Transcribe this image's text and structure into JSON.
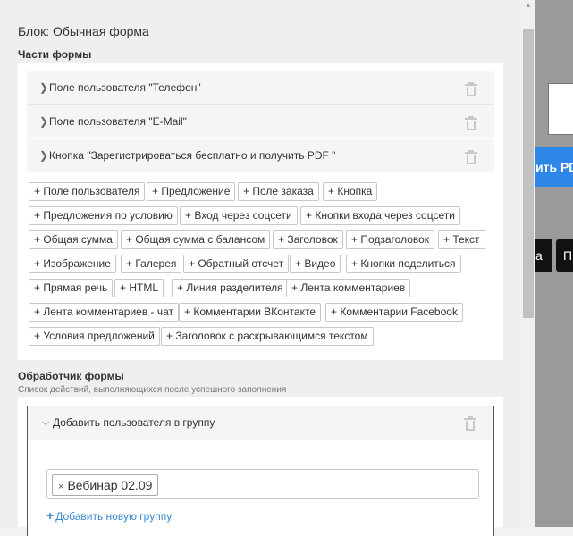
{
  "background": {
    "button_text": "ить PDF",
    "dark_btn_1": "а",
    "dark_btn_2": "П"
  },
  "panel": {
    "block_title": "Блок: Обычная форма",
    "parts_title": "Части формы",
    "parts": [
      "Поле пользователя \"Телефон\"",
      "Поле пользователя \"E-Mail\"",
      "Кнопка \"Зарегистрироваться бесплатно и получить PDF \""
    ],
    "tags": [
      "+ Поле пользователя",
      "+ Предложение",
      "+ Поле заказа",
      "+ Кнопка",
      "+ Предложения по условию",
      "+ Вход через соцсети",
      "+ Кнопки входа через соцсети",
      "+ Общая сумма",
      "+ Общая сумма с балансом",
      "+ Заголовок",
      "+ Подзаголовок",
      "+ Текст",
      "+ Изображение",
      "+ Галерея",
      "+ Обратный отсчет",
      "+ Видео",
      "+ Кнопки поделиться",
      "+ Прямая речь",
      "+ HTML",
      "+ Линия разделителя",
      "+ Лента комментариев",
      "+ Лента комментариев - чат",
      "+ Комментарии ВКонтакте",
      "+ Комментарии Facebook",
      "+ Условия предложений",
      "+ Заголовок с раскрывающимся текстом"
    ],
    "handler_title": "Обработчик формы",
    "handler_subtitle": "Список действий, выполняющихся после успешного заполнения",
    "action": {
      "label": "Добавить пользователя в группу",
      "chip": "Вебинар 02.09",
      "chip_remove": "×",
      "add_group": "Добавить новую группу"
    }
  },
  "icons": {
    "collapsed": "chevron-right-icon",
    "expanded": "chevron-down-icon",
    "delete": "trash-icon",
    "add": "plus-icon"
  },
  "colors": {
    "link": "#3a8ad0",
    "accent_button": "#2e86e6"
  }
}
